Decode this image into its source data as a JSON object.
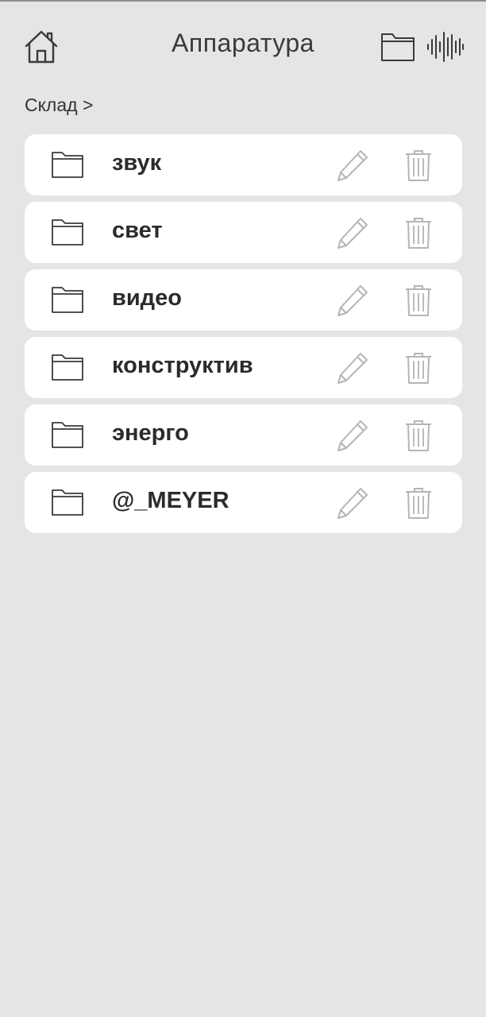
{
  "header": {
    "title": "Аппаратура",
    "home_icon": "home-icon",
    "new_folder_icon": "folder-icon",
    "audio_icon": "sound-wave-icon"
  },
  "breadcrumb": {
    "path": "Склад >"
  },
  "folders": [
    {
      "label": "звук"
    },
    {
      "label": "свет"
    },
    {
      "label": "видео"
    },
    {
      "label": "конструктив"
    },
    {
      "label": "энерго"
    },
    {
      "label": "@_MEYER"
    }
  ],
  "row_icons": {
    "folder": "folder-icon",
    "edit": "pencil-icon",
    "delete": "trash-icon"
  },
  "colors": {
    "background": "#e5e5e5",
    "card": "#ffffff",
    "text": "#2b2b2b",
    "icon_dark": "#3a3a3a",
    "icon_light": "#b5b5b5"
  }
}
